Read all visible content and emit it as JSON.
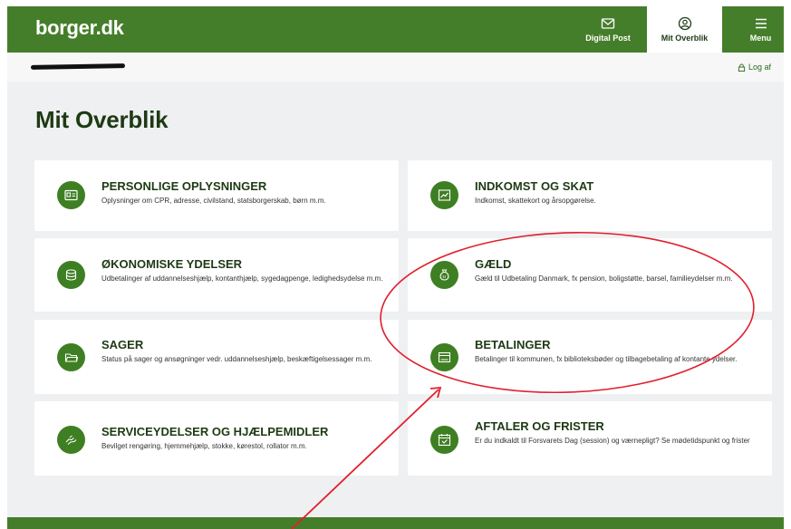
{
  "header": {
    "logo": "borger.dk",
    "nav": [
      {
        "label": "Digital Post",
        "icon": "envelope-icon"
      },
      {
        "label": "Mit Overblik",
        "icon": "user-circle-icon"
      },
      {
        "label": "Menu",
        "icon": "hamburger-icon"
      }
    ]
  },
  "userbar": {
    "logout": "Log af"
  },
  "page": {
    "title": "Mit Overblik"
  },
  "cards": [
    {
      "title": "PERSONLIGE OPLYSNINGER",
      "desc": "Oplysninger om CPR, adresse, civilstand, statsborgerskab, børn m.m.",
      "icon": "id-card-icon"
    },
    {
      "title": "INDKOMST OG SKAT",
      "desc": "Indkomst, skattekort og årsopgørelse.",
      "icon": "line-chart-icon"
    },
    {
      "title": "ØKONOMISKE YDELSER",
      "desc": "Udbetalinger af uddannelseshjælp, kontanthjælp, sygedagpenge, ledighedsydelse m.m.",
      "icon": "coins-icon"
    },
    {
      "title": "GÆLD",
      "desc": "Gæld til Udbetaling Danmark, fx pension, boligstøtte, barsel, familieydelser m.m.",
      "icon": "money-bag-icon"
    },
    {
      "title": "SAGER",
      "desc": "Status på sager og ansøgninger vedr. uddannelseshjælp, beskæftigelsessager m.m.",
      "icon": "folder-icon"
    },
    {
      "title": "BETALINGER",
      "desc": "Betalinger til kommunen, fx biblioteksbøder og tilbagebetaling af kontante ydelser.",
      "icon": "payment-card-icon"
    },
    {
      "title": "SERVICEYDELSER OG HJÆLPEMIDLER",
      "desc": "Bevilget rengøring, hjemmehjælp, stokke, kørestol, rollator m.m.",
      "icon": "helping-hand-icon"
    },
    {
      "title": "AFTALER OG FRISTER",
      "desc": "Er du indkaldt til Forsvarets Dag (session) og værnepligt? Se mødetidspunkt og frister",
      "icon": "calendar-check-icon"
    }
  ],
  "colors": {
    "brand_green": "#457e2a",
    "icon_green": "#3f7f23",
    "title_dark_green": "#1d3a14",
    "background": "#eff0f2",
    "annotation_red": "#e0202e"
  }
}
